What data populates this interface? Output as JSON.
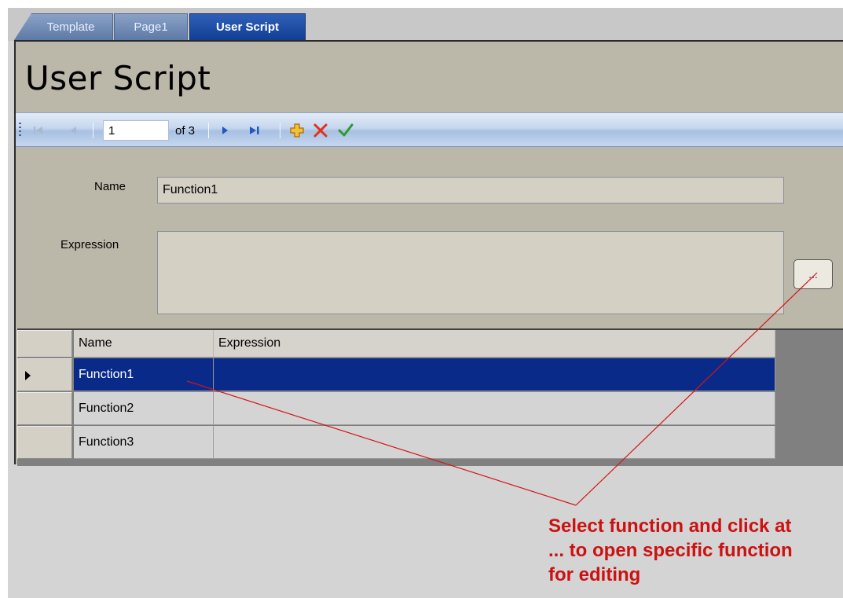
{
  "tabs": [
    {
      "label": "Template"
    },
    {
      "label": "Page1"
    },
    {
      "label": "User Script"
    }
  ],
  "page_title": "User Script",
  "navigator": {
    "position": "1",
    "count_label": "of 3"
  },
  "form": {
    "name_label": "Name",
    "name_value": "Function1",
    "expression_label": "Expression",
    "expression_value": "",
    "ellipsis_label": "..."
  },
  "grid": {
    "columns": [
      "Name",
      "Expression"
    ],
    "rows": [
      {
        "name": "Function1",
        "expression": "",
        "selected": true
      },
      {
        "name": "Function2",
        "expression": "",
        "selected": false
      },
      {
        "name": "Function3",
        "expression": "",
        "selected": false
      }
    ]
  },
  "annotation": {
    "lines": [
      "Select function and click at",
      "... to open specific function",
      "for editing"
    ],
    "color": "#cc1111"
  },
  "colors": {
    "panel": "#bcb8a9",
    "selected_row": "#0a2a8a",
    "active_tab": "#123f95"
  }
}
